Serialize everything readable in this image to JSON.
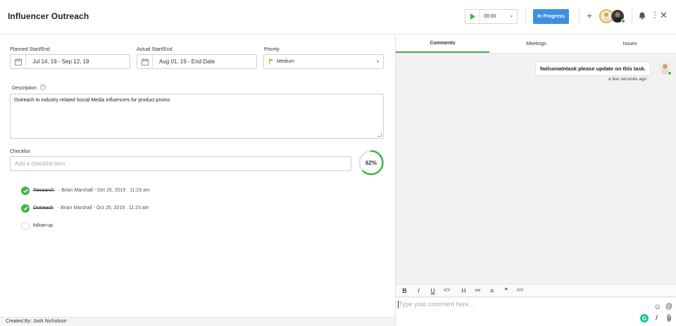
{
  "header": {
    "title": "Influencer Outreach",
    "timer": "00:00",
    "status": "In Progress"
  },
  "fields": {
    "planned_label": "Planned Start/End",
    "planned_value": "Jul 14, 19 - Sep 12, 19",
    "actual_label": "Actual Start/End",
    "actual_value": "Aug 01, 19 - End Date",
    "priority_label": "Priority",
    "priority_value": "Medium",
    "priority_color": "#8bc34a"
  },
  "description": {
    "label": "Description",
    "help": "?",
    "text": "Outreach to industry related Social Media influencers for product promo"
  },
  "checklist": {
    "label": "Checklist",
    "placeholder": "Add a checklist item",
    "progress_label": "62%",
    "progress": 0.62,
    "items": [
      {
        "title": "Research",
        "meta": "- Brian Marshall - Oct 25, 2019 . 11:23 am",
        "done": true
      },
      {
        "title": "Outreach",
        "meta": "- Brian Marshall - Oct 25, 2019 . 11:23 am",
        "done": true
      },
      {
        "title": "follow-up",
        "meta": "",
        "done": false
      }
    ]
  },
  "footer": {
    "created_by": "Created By: Josh Nicholson"
  },
  "panel": {
    "tabs": [
      "Comments",
      "Meetings",
      "Issues"
    ],
    "active_tab": "Comments",
    "comment_text": "fwilsonatntask please update on this task.",
    "comment_time": "a few seconds ago",
    "toolbar": [
      "B",
      "I",
      "U",
      "</>",
      "H",
      "≔",
      "≡",
      "❝",
      "</>"
    ],
    "compose_placeholder": "Type your comment here..."
  }
}
